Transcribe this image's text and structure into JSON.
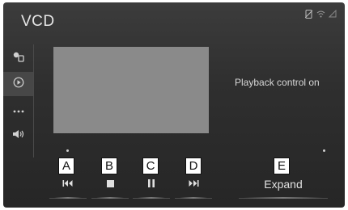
{
  "screen": {
    "title": "VCD",
    "playback_status": "Playback control on"
  },
  "status_icons": [
    "phone-disconnected-icon",
    "wifi-icon",
    "signal-icon"
  ],
  "sidebar": {
    "items": [
      {
        "name": "source-settings-icon"
      },
      {
        "name": "playback-icon",
        "active": true
      },
      {
        "name": "more-options-icon"
      },
      {
        "name": "volume-icon"
      }
    ]
  },
  "controls": [
    {
      "callout": "A",
      "icon": "previous-track-icon"
    },
    {
      "callout": "B",
      "icon": "stop-icon"
    },
    {
      "callout": "C",
      "icon": "pause-icon"
    },
    {
      "callout": "D",
      "icon": "next-track-icon"
    },
    {
      "callout": "E",
      "label": "Expand"
    }
  ],
  "colors": {
    "background": "#2f2f2f",
    "video_area": "#8a8a8a",
    "text": "#e0e0e0"
  }
}
